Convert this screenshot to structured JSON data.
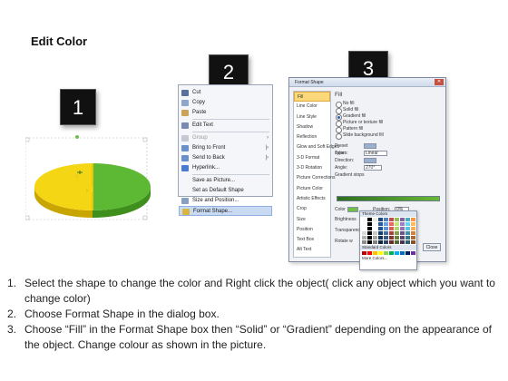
{
  "title": "Edit Color",
  "steps": [
    "1",
    "2",
    "3"
  ],
  "context_menu": {
    "items": [
      {
        "label": "Cut",
        "icon": "scissors-icon",
        "disabled": false
      },
      {
        "label": "Copy",
        "icon": "copy-icon",
        "disabled": false
      },
      {
        "label": "Paste",
        "icon": "paste-icon",
        "disabled": false
      },
      {
        "label": "Edit Text",
        "icon": "edit-text-icon",
        "disabled": false
      },
      {
        "label": "Group",
        "icon": "group-icon",
        "disabled": true,
        "arrow": true
      },
      {
        "label": "Bring to Front",
        "icon": "bring-front-icon",
        "disabled": false,
        "arrow": true
      },
      {
        "label": "Send to Back",
        "icon": "send-back-icon",
        "disabled": false,
        "arrow": true
      },
      {
        "label": "Hyperlink...",
        "icon": "hyperlink-icon",
        "disabled": false
      },
      {
        "label": "Save as Picture...",
        "icon": "",
        "disabled": false
      },
      {
        "label": "Set as Default Shape",
        "icon": "",
        "disabled": false
      },
      {
        "label": "Size and Position...",
        "icon": "size-icon",
        "disabled": false
      },
      {
        "label": "Format Shape...",
        "icon": "format-icon",
        "disabled": false,
        "highlight": true
      }
    ]
  },
  "format_shape": {
    "title": "Format Shape",
    "sidebar": [
      "Fill",
      "Line Color",
      "Line Style",
      "Shadow",
      "Reflection",
      "Glow and Soft Edges",
      "3-D Format",
      "3-D Rotation",
      "Picture Corrections",
      "Picture Color",
      "Artistic Effects",
      "Crop",
      "Size",
      "Position",
      "Text Box",
      "Alt Text"
    ],
    "heading": "Fill",
    "options": [
      {
        "label": "No fill",
        "on": false
      },
      {
        "label": "Solid fill",
        "on": false
      },
      {
        "label": "Gradient fill",
        "on": true
      },
      {
        "label": "Picture or texture fill",
        "on": false
      },
      {
        "label": "Pattern fill",
        "on": false
      },
      {
        "label": "Slide background fill",
        "on": false
      }
    ],
    "fields": {
      "preset": "Preset colors:",
      "type_label": "Type:",
      "type_value": "Linear",
      "direction": "Direction:",
      "angle_label": "Angle:",
      "angle_value": "270°",
      "stops": "Gradient stops",
      "color": "Color",
      "position_label": "Position:",
      "position_value": "0%",
      "brightness": "Brightness",
      "transparency": "Transparency",
      "rotate": "Rotate w"
    },
    "close": "Close"
  },
  "palette": {
    "theme": "Theme Colors",
    "standard": "Standard Colors",
    "more": "More Colors..."
  },
  "instructions": [
    {
      "num": "1.",
      "text": "Select the shape to change the color and Right click the object( click any object which you want to change color)"
    },
    {
      "num": "2.",
      "text": "Choose Format Shape in the dialog box."
    },
    {
      "num": "3.",
      "text": "Choose “Fill” in the Format Shape box then “Solid” or “Gradient” depending on the appearance of the object. Change colour as shown in the picture."
    }
  ]
}
